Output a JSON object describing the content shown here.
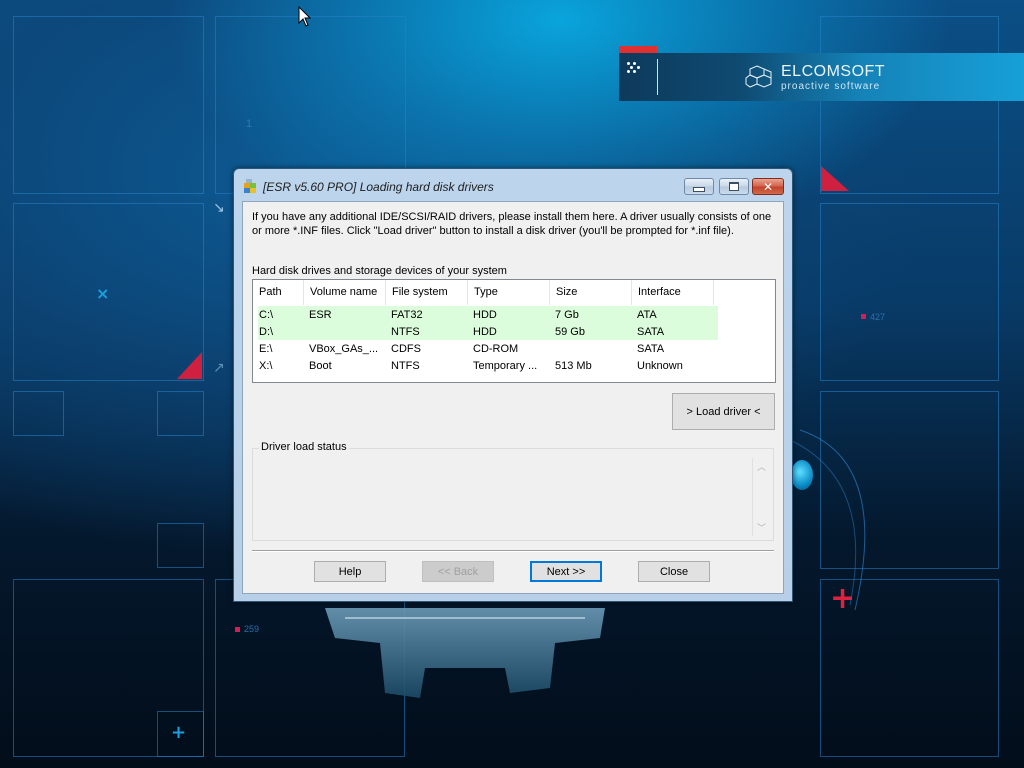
{
  "desktop": {
    "banner": {
      "brand": "ELCOMSOFT",
      "tagline": "proactive software"
    },
    "decor_labels": [
      "1",
      "427",
      "259"
    ],
    "colors": {
      "accent_red": "#e0302f",
      "background_blue": "#0b4f86",
      "grid_line": "#2882c8"
    }
  },
  "window": {
    "title": "[ESR v5.60 PRO]  Loading hard disk drivers",
    "icon": "app-installer-icon",
    "caption_buttons": {
      "minimize": "minimize-icon",
      "maximize": "maximize-icon",
      "close": "close-icon"
    },
    "intro_text": "If you have any additional IDE/SCSI/RAID drivers, please install them here. A driver usually consists of one or more *.INF files. Click \"Load driver\" button to install a disk driver (you'll be prompted for *.inf file).",
    "list_caption": "Hard disk drives and storage devices of your system",
    "table": {
      "columns": [
        "Path",
        "Volume name",
        "File system",
        "Type",
        "Size",
        "Interface"
      ],
      "rows": [
        {
          "path": "C:\\",
          "volume": "ESR",
          "fs": "FAT32",
          "type": "HDD",
          "size": "7 Gb",
          "iface": "ATA",
          "highlighted": true
        },
        {
          "path": "D:\\",
          "volume": "",
          "fs": "NTFS",
          "type": "HDD",
          "size": "59 Gb",
          "iface": "SATA",
          "highlighted": true
        },
        {
          "path": "E:\\",
          "volume": "VBox_GAs_...",
          "fs": "CDFS",
          "type": "CD-ROM",
          "size": "",
          "iface": "SATA",
          "highlighted": false
        },
        {
          "path": "X:\\",
          "volume": "Boot",
          "fs": "NTFS",
          "type": "Temporary ...",
          "size": "513 Mb",
          "iface": "Unknown",
          "highlighted": false
        }
      ],
      "highlight_color": "#dcfddc"
    },
    "load_driver_label": "> Load driver <",
    "status_group_label": "Driver load status",
    "status_text": "",
    "buttons": {
      "help": "Help",
      "back": "<< Back",
      "next": "Next >>",
      "close": "Close"
    }
  }
}
